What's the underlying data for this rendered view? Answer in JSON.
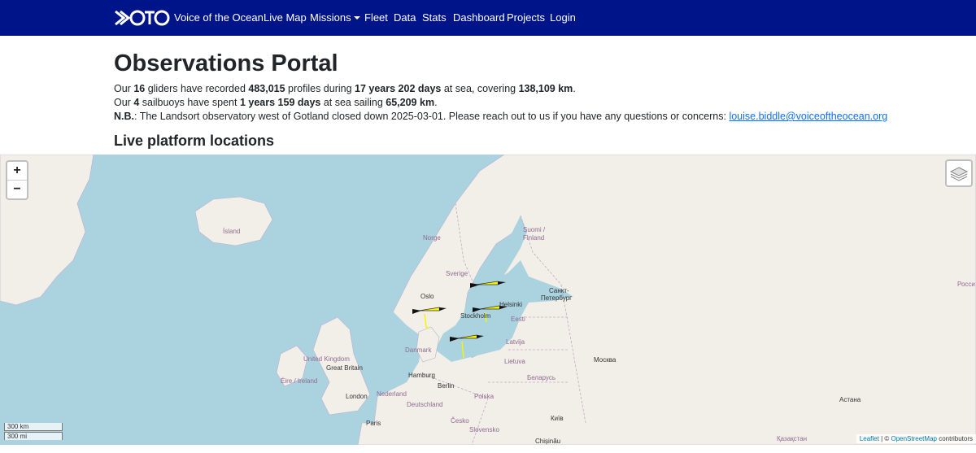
{
  "nav": {
    "brand_logo_text": "VOTO",
    "brand": "Voice of the Ocean",
    "items": [
      "Live Map",
      "Missions",
      "Fleet",
      "Data",
      "Stats",
      "Dashboard",
      "Projects",
      "Login"
    ]
  },
  "page": {
    "title": "Observations Portal",
    "gliders": {
      "p1": "Our ",
      "count": "16",
      "p2": " gliders have recorded ",
      "profiles": "483,015",
      "p3": " profiles during ",
      "duration": "17 years 202 days",
      "p4": " at sea, covering ",
      "distance": "138,109 km",
      "p5": "."
    },
    "sailbuoys": {
      "p1": "Our ",
      "count": "4",
      "p2": " sailbuoys have spent ",
      "duration": "1 years 159 days",
      "p3": " at sea sailing ",
      "distance": "65,209 km",
      "p4": "."
    },
    "note": {
      "label": "N.B.",
      "text": ": The Landsort observatory west of Gotland closed down 2025-03-01. Please reach out to us if you have any questions or concerns: ",
      "email": "louise.biddle@voiceoftheocean.org"
    },
    "subtitle": "Live platform locations"
  },
  "map": {
    "zoom_in": "+",
    "zoom_out": "−",
    "scale_km": "300 km",
    "scale_mi": "300 mi",
    "attribution_leaflet": "Leaflet",
    "attribution_sep": " | © ",
    "attribution_osm": "OpenStreetMap",
    "attribution_tail": " contributors",
    "labels": {
      "island": "Ísland",
      "norge": "Norge",
      "sverige": "Sverige",
      "suomi1": "Suomi /",
      "suomi2": "Finland",
      "oslo": "Oslo",
      "stockholm": "Stockholm",
      "helsinki": "Helsinki",
      "spb1": "Санкт-",
      "spb2": "Петербург",
      "eesti": "Eesti",
      "latvija": "Latvija",
      "lietuva": "Lietuva",
      "danmark": "Danmark",
      "uk1": "United Kingdom",
      "uk2": "Great Britain",
      "eire": "Éire / Ireland",
      "london": "London",
      "nederland": "Nederland",
      "hamburg": "Hamburg",
      "berlin": "Berlin",
      "deutschland": "Deutschland",
      "polska": "Polska",
      "belarus": "Беларусь",
      "moskva": "Москва",
      "paris": "Paris",
      "cesko": "Česko",
      "slovensko": "Slovensko",
      "kyiv": "Київ",
      "astana": "Астана",
      "kazakhstan": "Қазақстан",
      "chisinau": "Chișinău",
      "rossia": "Росси"
    },
    "colors": {
      "water": "#aad3df",
      "land": "#f2efe9",
      "glider": "#f5f500",
      "nav": "#001489"
    }
  }
}
